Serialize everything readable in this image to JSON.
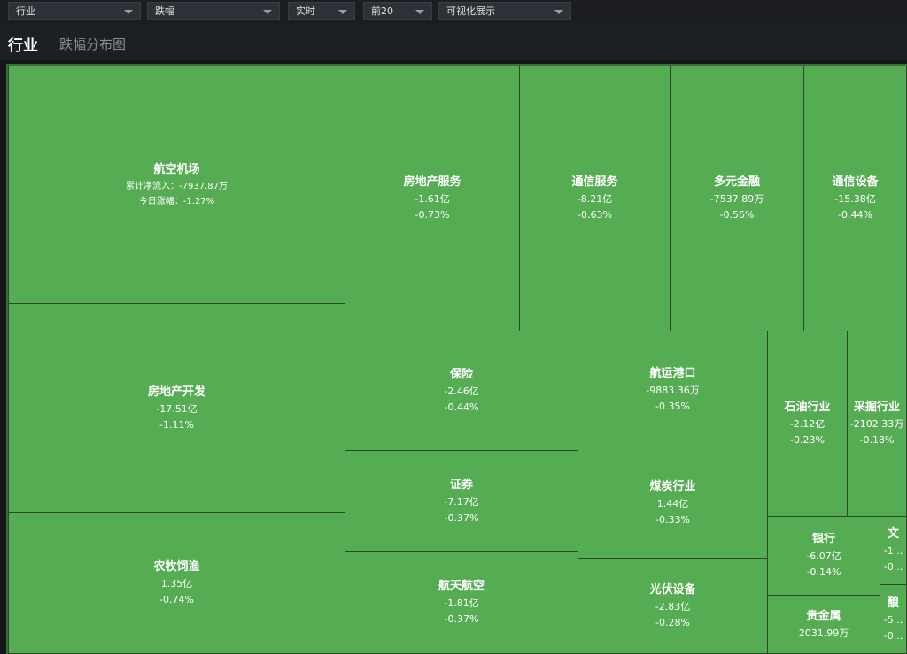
{
  "filters": [
    {
      "value": "行业",
      "name": "filter-category"
    },
    {
      "value": "跌幅",
      "name": "filter-sort"
    },
    {
      "value": "实时",
      "name": "filter-period"
    },
    {
      "value": "前20",
      "name": "filter-topn"
    },
    {
      "value": "可视化展示",
      "name": "filter-view"
    }
  ],
  "header": {
    "title": "行业",
    "subtitle": "跌幅分布图"
  },
  "colors": {
    "tile_fill": "#55ac53",
    "tile_border": "#2b4a2b",
    "background": "#14161a"
  },
  "tiles": [
    {
      "name": "航空机场",
      "line1": "累计净流入：-7937.87万",
      "line2": "今日涨幅：-1.27%"
    },
    {
      "name": "房地产开发",
      "line1": "-17.51亿",
      "line2": "-1.11%"
    },
    {
      "name": "农牧饲渔",
      "line1": "1.35亿",
      "line2": "-0.74%"
    },
    {
      "name": "房地产服务",
      "line1": "-1.61亿",
      "line2": "-0.73%"
    },
    {
      "name": "通信服务",
      "line1": "-8.21亿",
      "line2": "-0.63%"
    },
    {
      "name": "多元金融",
      "line1": "-7537.89万",
      "line2": "-0.56%"
    },
    {
      "name": "通信设备",
      "line1": "-15.38亿",
      "line2": "-0.44%"
    },
    {
      "name": "保险",
      "line1": "-2.46亿",
      "line2": "-0.44%"
    },
    {
      "name": "证券",
      "line1": "-7.17亿",
      "line2": "-0.37%"
    },
    {
      "name": "航天航空",
      "line1": "-1.81亿",
      "line2": "-0.37%"
    },
    {
      "name": "航运港口",
      "line1": "-9883.36万",
      "line2": "-0.35%"
    },
    {
      "name": "煤炭行业",
      "line1": "1.44亿",
      "line2": "-0.33%"
    },
    {
      "name": "光伏设备",
      "line1": "-2.83亿",
      "line2": "-0.28%"
    },
    {
      "name": "石油行业",
      "line1": "-2.12亿",
      "line2": "-0.23%"
    },
    {
      "name": "采掘行业",
      "line1": "-2102.33万",
      "line2": "-0.18%"
    },
    {
      "name": "银行",
      "line1": "-6.07亿",
      "line2": "-0.14%"
    },
    {
      "name": "贵金属",
      "line1": "2031.99万",
      "line2": ""
    },
    {
      "name": "文",
      "line1": "-1...",
      "line2": "-0..."
    },
    {
      "name": "酿",
      "line1": "-5...",
      "line2": "-0..."
    }
  ]
}
